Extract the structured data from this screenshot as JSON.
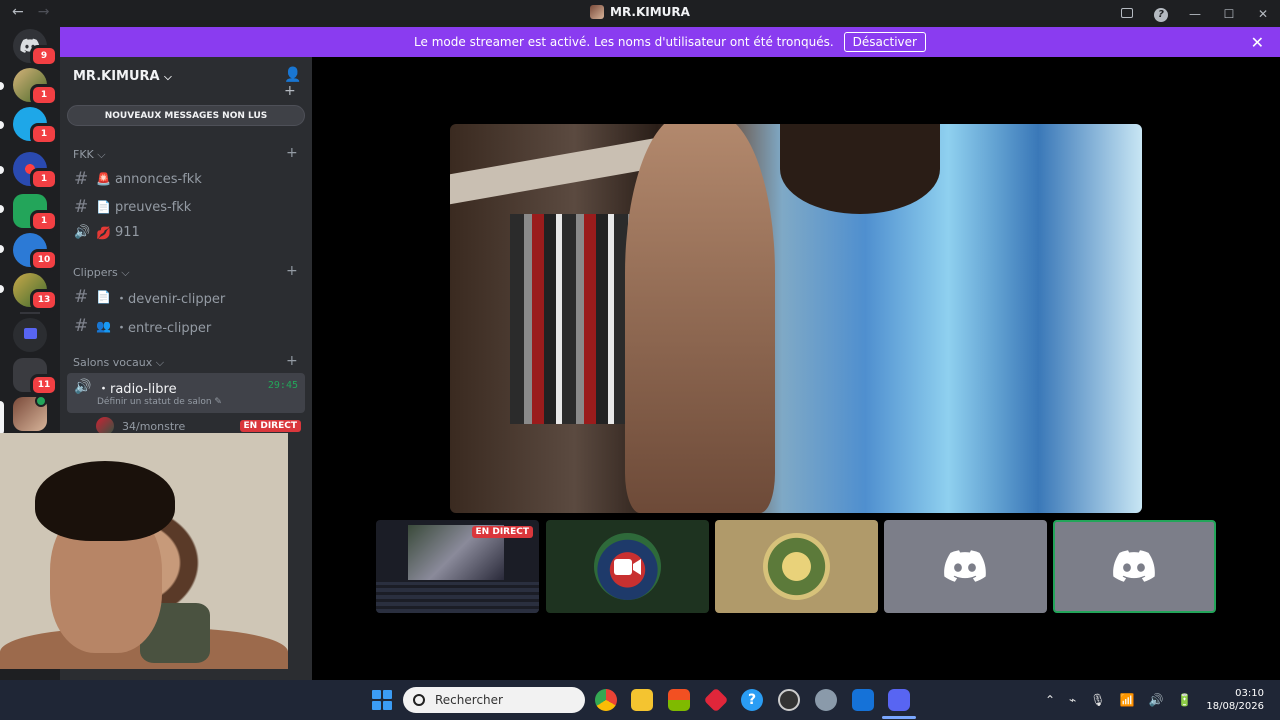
{
  "window": {
    "title": "MR.KIMURA",
    "back_icon": "←",
    "forward_icon": "→"
  },
  "banner": {
    "text": "Le mode streamer est activé. Les noms d'utilisateur ont été tronqués.",
    "button": "Désactiver",
    "close": "✕"
  },
  "rail": {
    "home_badge": "9",
    "servers": [
      {
        "badge": "1"
      },
      {
        "badge": "1"
      },
      {
        "badge": "1"
      },
      {
        "badge": "1"
      },
      {
        "badge": "10"
      },
      {
        "badge": "13"
      },
      {
        "badge": ""
      },
      {
        "badge": "11"
      },
      {
        "badge": ""
      }
    ]
  },
  "sidebar": {
    "server_name": "MR.KIMURA",
    "unread": "NOUVEAUX MESSAGES NON LUS",
    "categories": [
      {
        "name": "FKK",
        "channels": [
          {
            "icon": "#",
            "emoji": "🚨",
            "name": "annonces-fkk"
          },
          {
            "icon": "#",
            "emoji": "📄",
            "name": "preuves-fkk"
          },
          {
            "icon": "🔊",
            "emoji": "💋",
            "name": "911"
          }
        ]
      },
      {
        "name": "Clippers",
        "channels": [
          {
            "icon": "#",
            "emoji": "📄",
            "name": "・devenir-clipper"
          },
          {
            "icon": "#",
            "emoji": "👥",
            "name": "・entre-clipper"
          }
        ]
      },
      {
        "name": "Salons vocaux",
        "channels": []
      }
    ],
    "voice": {
      "name": "・radio-libre",
      "time": "29:45",
      "status": "Définir un statut de salon ✎",
      "member": "34/monstre",
      "live": "EN DIRECT"
    }
  },
  "stage": {
    "tile_live": "EN DIRECT"
  },
  "taskbar": {
    "search_placeholder": "Rechercher",
    "time": "03:10",
    "date": "18/08/2026"
  }
}
